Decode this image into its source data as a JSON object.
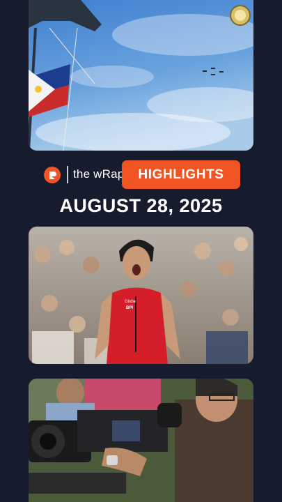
{
  "brand": {
    "name": "the wRap",
    "logo_icon": "rappler-logo-icon",
    "accent_color": "#f05523"
  },
  "highlights_label": "HIGHLIGHTS",
  "date_title": "AUGUST 28, 2025",
  "photos": [
    {
      "subject": "flag-and-sky"
    },
    {
      "subject": "tennis-player-celebrating",
      "shirt_text": [
        "Globe",
        "BPI"
      ]
    },
    {
      "subject": "camera-operators"
    }
  ],
  "colors": {
    "background": "#161b2e",
    "pill": "#f05523",
    "text": "#ffffff"
  }
}
